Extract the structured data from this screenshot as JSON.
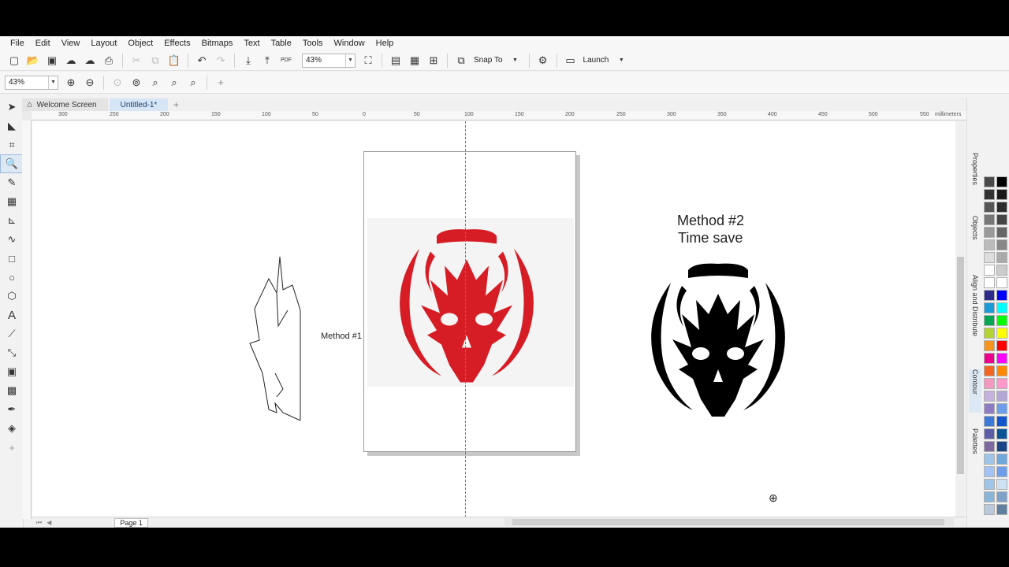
{
  "menu": [
    "File",
    "Edit",
    "View",
    "Layout",
    "Object",
    "Effects",
    "Bitmaps",
    "Text",
    "Table",
    "Tools",
    "Window",
    "Help"
  ],
  "toolbar": {
    "zoom_value": "43%",
    "snap_to_label": "Snap To",
    "launch_label": "Launch",
    "pdf_label": "PDF"
  },
  "propertybar": {
    "zoom_value": "43%"
  },
  "tabs": [
    "Welcome Screen",
    "Untitled-1*"
  ],
  "ruler": {
    "h_ticks": [
      "300",
      "250",
      "200",
      "150",
      "100",
      "50",
      "0",
      "50",
      "100",
      "150",
      "200",
      "250",
      "300",
      "350",
      "400",
      "450",
      "500",
      "550"
    ],
    "units": "millimeters"
  },
  "canvas": {
    "method1_label": "Method #1",
    "method2_title": "Method #2",
    "method2_subtitle": "Time save"
  },
  "status": {
    "page_label": "Page 1"
  },
  "dockers": [
    "Properties",
    "Objects",
    "Align and Distribute",
    "Contour",
    "Palettes"
  ],
  "colors": {
    "accent_red": "#d61c24",
    "logo_black": "#000000",
    "guide": "#6a6ad8",
    "tab_active": "#d6e6f7"
  },
  "palette_colors": [
    "#4a4a4a",
    "#000000",
    "#333333",
    "#1a1a1a",
    "#555555",
    "#2b2b2b",
    "#777777",
    "#444444",
    "#999999",
    "#666666",
    "#bbbbbb",
    "#888888",
    "#dddddd",
    "#aaaaaa",
    "#ffffff",
    "#cccccc",
    "#ffffff",
    "#ffffff",
    "#2e2a8c",
    "#0000ff",
    "#1a9ad6",
    "#00ffff",
    "#00a651",
    "#00ff00",
    "#b3d334",
    "#ffff00",
    "#f7941d",
    "#ff0000",
    "#ec008c",
    "#ff00ff",
    "#f26522",
    "#ff8800",
    "#f49ac1",
    "#ff99cc",
    "#c7b2de",
    "#b4a7d6",
    "#8e7cc3",
    "#6d9eeb",
    "#3c78d8",
    "#1155cc",
    "#5b5ea6",
    "#0b5394",
    "#7f6aa0",
    "#1c4587",
    "#9fc5e8",
    "#6fa8dc",
    "#a4c2f4",
    "#6d9eeb",
    "#9fc5e8",
    "#cfe2f3",
    "#8ab4d8",
    "#7fa3c8",
    "#b9c9db",
    "#5f7f9f"
  ]
}
